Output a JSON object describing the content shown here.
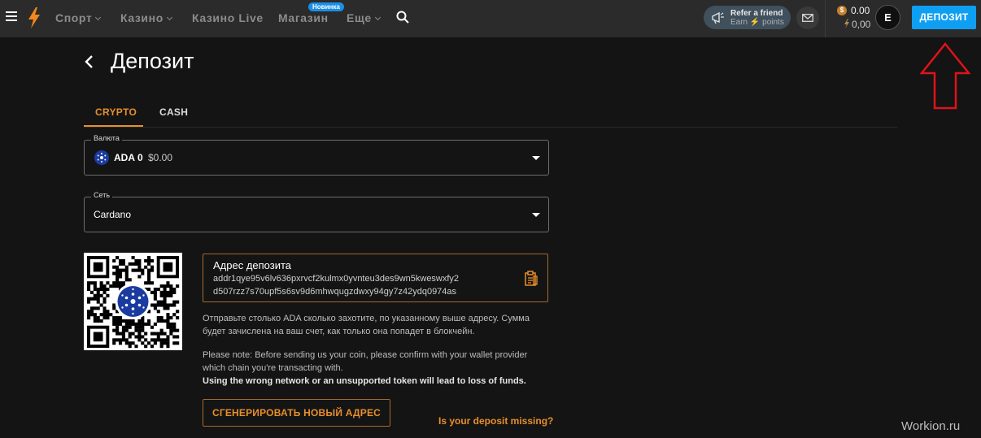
{
  "header": {
    "nav": [
      {
        "label": "Спорт",
        "dropdown": true
      },
      {
        "label": "Казино",
        "dropdown": true
      },
      {
        "label": "Казино Live",
        "dropdown": false
      },
      {
        "label": "Магазин",
        "dropdown": false,
        "badge": "Новинка"
      },
      {
        "label": "Еще",
        "dropdown": true
      }
    ],
    "refer": {
      "title": "Refer a friend",
      "subtitle": "Earn ⚡ points"
    },
    "balance": {
      "coin_glyph": "$",
      "main": "0.00",
      "points": "0,00"
    },
    "avatar": "E",
    "deposit_button": "ДЕПОЗИТ"
  },
  "page": {
    "title": "Депозит",
    "tabs": [
      {
        "label": "CRYPTO",
        "active": true
      },
      {
        "label": "CASH",
        "active": false
      }
    ]
  },
  "currency": {
    "label": "Валюта",
    "code": "ADA",
    "amount": "0",
    "usd": "$0.00"
  },
  "network": {
    "label": "Сеть",
    "value": "Cardano"
  },
  "address": {
    "label": "Адрес депозита",
    "line1": "addr1qye95v6lv636pxrvcf2kulmx0yvnteu3des9wn5kweswxfy2",
    "line2": "d507rzz7s70upf5s6sv9d6mhwqugzdwxy94gy7z42ydq0974as"
  },
  "info": {
    "p1_line1": "Отправьте столько ADA сколько захотите, по указанному выше адресу. Сумма",
    "p1_line2": "будет зачислена на ваш счет, как только она попадет в блокчейн.",
    "p2_line1": "Please note: Before sending us your coin, please confirm with your wallet provider",
    "p2_line2": "which chain you're transacting with.",
    "p2_bold": "Using the wrong network or an unsupported token will lead to loss of funds."
  },
  "actions": {
    "generate": "СГЕНЕРИРОВАТЬ НОВЫЙ АДРЕС",
    "missing": "Is your deposit missing?"
  },
  "watermark": "Workion.ru",
  "colors": {
    "accent": "#e88f2a",
    "deposit_blue": "#0f9ff2",
    "annotation_red": "#e0121a",
    "background": "#141414",
    "header": "#2b2b2b"
  }
}
